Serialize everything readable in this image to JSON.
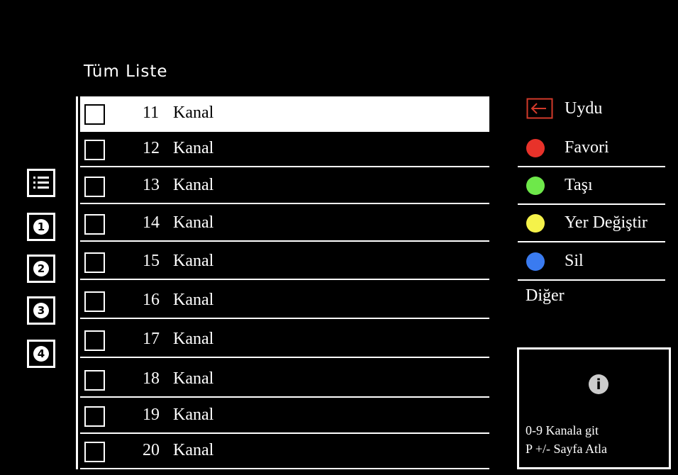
{
  "title": "Tüm Liste",
  "left_icons": [
    {
      "icon": "list-icon"
    },
    {
      "icon": "list-1-icon",
      "label": "1"
    },
    {
      "icon": "list-2-icon",
      "label": "2"
    },
    {
      "icon": "list-3-icon",
      "label": "3"
    },
    {
      "icon": "list-4-icon",
      "label": "4"
    }
  ],
  "channels": [
    {
      "number": "11",
      "name": "Kanal",
      "selected": true
    },
    {
      "number": "12",
      "name": "Kanal"
    },
    {
      "number": "13",
      "name": "Kanal"
    },
    {
      "number": "14",
      "name": "Kanal"
    },
    {
      "number": "15",
      "name": "Kanal"
    },
    {
      "number": "16",
      "name": "Kanal"
    },
    {
      "number": "17",
      "name": "Kanal"
    },
    {
      "number": "18",
      "name": "Kanal"
    },
    {
      "number": "19",
      "name": "Kanal"
    },
    {
      "number": "20",
      "name": "Kanal"
    }
  ],
  "menu": {
    "source": {
      "label": "Uydu",
      "icon": "input-source-icon",
      "color": "#d23a2a"
    },
    "red": {
      "label": "Favori",
      "color": "#e8322a"
    },
    "green": {
      "label": "Taşı",
      "color": "#6ee84a"
    },
    "yellow": {
      "label": "Yer Değiştir",
      "color": "#f5f24a"
    },
    "blue": {
      "label": "Sil",
      "color": "#3a7bf0"
    },
    "other": "Diğer"
  },
  "info": {
    "icon": "info-icon",
    "line1": "0-9 Kanala git",
    "line2": "P +/- Sayfa Atla"
  }
}
